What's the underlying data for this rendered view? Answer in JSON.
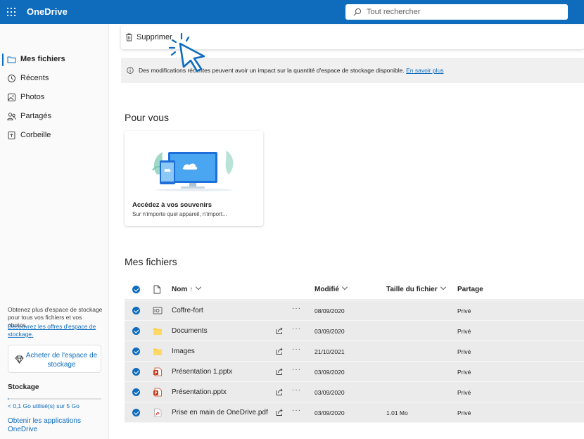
{
  "header": {
    "app_title": "OneDrive",
    "search_placeholder": "Tout rechercher"
  },
  "sidebar": {
    "items": [
      {
        "label": "Mes fichiers",
        "icon": "folder-icon",
        "active": true
      },
      {
        "label": "Récents",
        "icon": "recent-icon",
        "active": false
      },
      {
        "label": "Photos",
        "icon": "photo-icon",
        "active": false
      },
      {
        "label": "Partagés",
        "icon": "people-icon",
        "active": false
      },
      {
        "label": "Corbeille",
        "icon": "recycle-bin-icon",
        "active": false
      }
    ],
    "promo_text": "Obtenez plus d'espace de stockage pour tous vos fichiers et vos photos.",
    "promo_link": "Découvrez les offres d'espace de stockage.",
    "buy_button": "Acheter de l'espace de stockage",
    "storage_title": "Stockage",
    "storage_usage": "< 0,1 Go utilisé(s) sur 5 Go",
    "storage_used_fraction": 0.01,
    "get_apps": "Obtenir les applications OneDrive"
  },
  "command_bar": {
    "delete_label": "Supprimer"
  },
  "info_bar": {
    "message": "Des modifications récentes peuvent avoir un impact sur la quantité d'espace de stockage disponible.",
    "link": "En savoir plus"
  },
  "for_you": {
    "title": "Pour vous",
    "card_title": "Accédez à vos souvenirs",
    "card_subtitle": "Sur n'importe quel appareil, n'import..."
  },
  "files": {
    "title": "Mes fichiers",
    "columns": {
      "name": "Nom",
      "sort_arrow": "↑",
      "modified": "Modifié",
      "size": "Taille du fichier",
      "sharing": "Partage"
    },
    "rows": [
      {
        "name": "Coffre-fort",
        "icon": "vault-icon",
        "modified": "08/09/2020",
        "size": "",
        "sharing": "Privé",
        "shareable": false
      },
      {
        "name": "Documents",
        "icon": "folder-icon",
        "modified": "03/09/2020",
        "size": "",
        "sharing": "Privé",
        "shareable": true
      },
      {
        "name": "Images",
        "icon": "folder-icon",
        "modified": "21/10/2021",
        "size": "",
        "sharing": "Privé",
        "shareable": true
      },
      {
        "name": "Présentation 1.pptx",
        "icon": "powerpoint-icon",
        "modified": "03/09/2020",
        "size": "",
        "sharing": "Privé",
        "shareable": true
      },
      {
        "name": "Présentation.pptx",
        "icon": "powerpoint-icon",
        "modified": "03/09/2020",
        "size": "",
        "sharing": "Privé",
        "shareable": true
      },
      {
        "name": "Prise en main de OneDrive.pdf",
        "icon": "pdf-icon",
        "modified": "03/09/2020",
        "size": "1.01 Mo",
        "sharing": "Privé",
        "shareable": true
      }
    ]
  },
  "colors": {
    "brand": "#0f6cbd",
    "folder": "#ffc83d",
    "powerpoint": "#c43e1c",
    "selected_row": "#ebebeb"
  }
}
